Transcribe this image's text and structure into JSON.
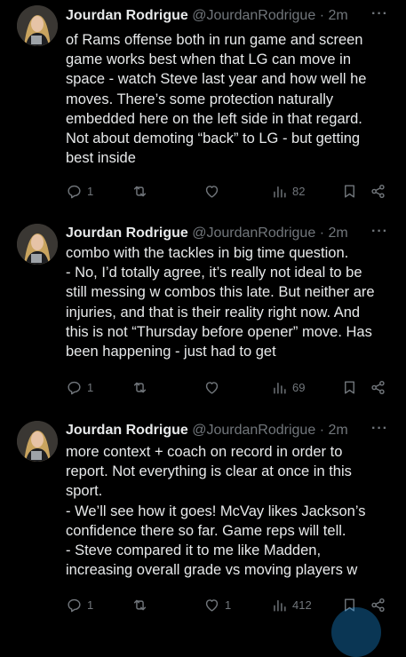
{
  "tweets": [
    {
      "name": "Jourdan Rodrigue",
      "handle": "@JourdanRodrigue",
      "dot": "·",
      "time": "2m",
      "lines": [
        "of Rams offense both in run game and screen",
        "game works best when that LG can move in",
        "space - watch Steve last year and how well he",
        "moves. There’s some protection naturally",
        "embedded here on the left side in that regard.",
        "Not about demoting “back” to LG - but getting",
        "best inside"
      ],
      "replies": "1",
      "reposts": "",
      "likes": "",
      "views": "82"
    },
    {
      "name": "Jourdan Rodrigue",
      "handle": "@JourdanRodrigue",
      "dot": "·",
      "time": "2m",
      "lines": [
        "combo with the tackles in big time question.",
        "- No, I’d totally agree, it’s really not ideal to be",
        "still messing w combos this late. But neither are",
        "injuries, and that is their reality right now. And",
        "this is not “Thursday before opener” move. Has",
        "been happening - just had to get"
      ],
      "replies": "1",
      "reposts": "",
      "likes": "",
      "views": "69"
    },
    {
      "name": "Jourdan Rodrigue",
      "handle": "@JourdanRodrigue",
      "dot": "·",
      "time": "2m",
      "lines": [
        "more context + coach on record in order to",
        "report. Not everything is clear at once in this",
        "sport.",
        "- We’ll see how it goes! McVay likes Jackson’s",
        "confidence there so far. Game reps will tell.",
        "- Steve compared it to me like Madden,",
        "increasing overall grade vs moving players w"
      ],
      "replies": "1",
      "reposts": "",
      "likes": "1",
      "views": "412"
    }
  ],
  "more_icon": "···",
  "colors": {
    "background": "#000000",
    "text": "#e7e9ea",
    "muted": "#71767b",
    "accent": "#1d9bf0"
  },
  "icons": [
    "reply-icon",
    "repost-icon",
    "like-icon",
    "views-icon",
    "bookmark-icon",
    "share-icon"
  ]
}
